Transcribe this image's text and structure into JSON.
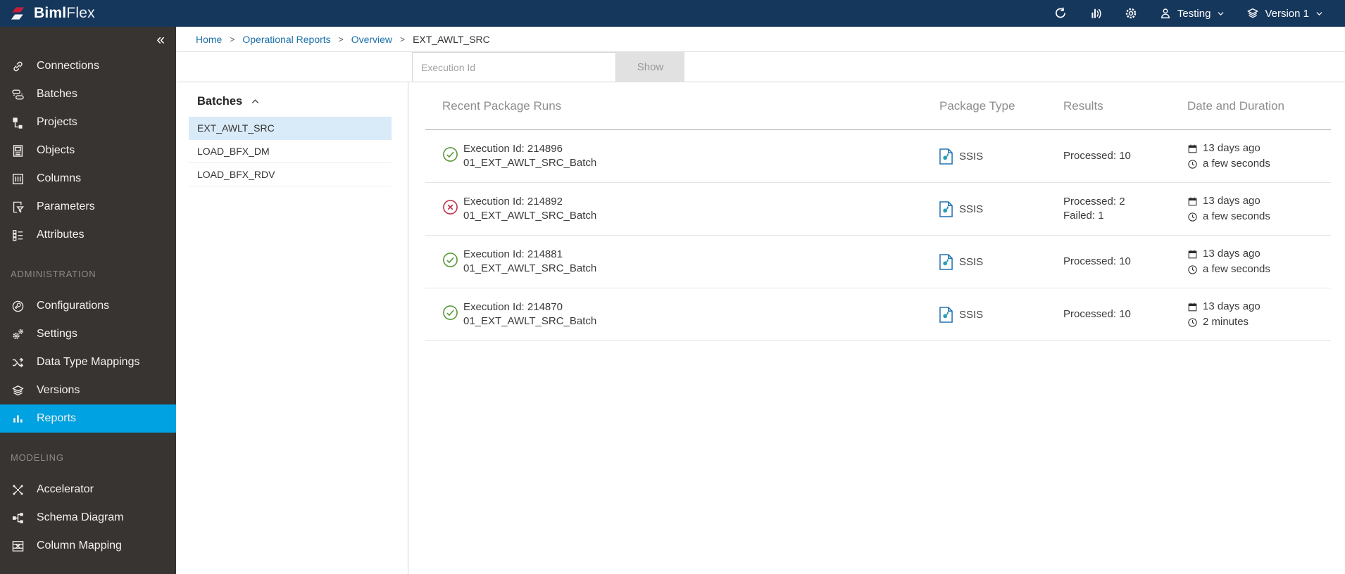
{
  "topbar": {
    "logo_bold": "Biml",
    "logo_light": "Flex",
    "user_label": "Testing",
    "version_label": "Version 1"
  },
  "breadcrumb": {
    "sep": ">",
    "home": "Home",
    "operational_reports": "Operational Reports",
    "overview": "Overview",
    "current": "EXT_AWLT_SRC"
  },
  "sidebar": {
    "collapse_glyph": "«",
    "sections": [
      {
        "items": [
          {
            "label": "Connections"
          },
          {
            "label": "Batches"
          },
          {
            "label": "Projects"
          },
          {
            "label": "Objects"
          },
          {
            "label": "Columns"
          },
          {
            "label": "Parameters"
          },
          {
            "label": "Attributes"
          }
        ]
      },
      {
        "header": "ADMINISTRATION",
        "items": [
          {
            "label": "Configurations"
          },
          {
            "label": "Settings"
          },
          {
            "label": "Data Type Mappings"
          },
          {
            "label": "Versions"
          },
          {
            "label": "Reports",
            "active": "true"
          }
        ]
      },
      {
        "header": "MODELING",
        "items": [
          {
            "label": "Accelerator"
          },
          {
            "label": "Schema Diagram"
          },
          {
            "label": "Column Mapping"
          }
        ]
      }
    ]
  },
  "batches_panel": {
    "title": "Batches",
    "items": [
      {
        "label": "EXT_AWLT_SRC",
        "selected": "true"
      },
      {
        "label": "LOAD_BFX_DM",
        "selected": "false"
      },
      {
        "label": "LOAD_BFX_RDV",
        "selected": "false"
      }
    ]
  },
  "filter": {
    "placeholder": "Execution Id",
    "show_label": "Show"
  },
  "table": {
    "col_runs": "Recent Package Runs",
    "col_package_type": "Package Type",
    "col_results": "Results",
    "col_date": "Date and Duration",
    "rows": [
      {
        "status": "success",
        "execution_id": "Execution Id: 214896",
        "batch_name": "01_EXT_AWLT_SRC_Batch",
        "package_type": "SSIS",
        "results_line1": "Processed: 10",
        "results_line2": "",
        "date": "13 days ago",
        "duration": "a few seconds"
      },
      {
        "status": "failed",
        "execution_id": "Execution Id: 214892",
        "batch_name": "01_EXT_AWLT_SRC_Batch",
        "package_type": "SSIS",
        "results_line1": "Processed: 2",
        "results_line2": "Failed: 1",
        "date": "13 days ago",
        "duration": "a few seconds"
      },
      {
        "status": "success",
        "execution_id": "Execution Id: 214881",
        "batch_name": "01_EXT_AWLT_SRC_Batch",
        "package_type": "SSIS",
        "results_line1": "Processed: 10",
        "results_line2": "",
        "date": "13 days ago",
        "duration": "a few seconds"
      },
      {
        "status": "success",
        "execution_id": "Execution Id: 214870",
        "batch_name": "01_EXT_AWLT_SRC_Batch",
        "package_type": "SSIS",
        "results_line1": "Processed: 10",
        "results_line2": "",
        "date": "13 days ago",
        "duration": "2 minutes"
      }
    ]
  },
  "colors": {
    "topbar": "#16375c",
    "sidebar": "#373431",
    "accent_blue": "#00a2e1",
    "link_blue": "#1b6fa9",
    "success_green": "#5b9a3c",
    "error_red": "#c2354f",
    "selected_row": "#d9eaf8",
    "logo_red": "#c41e3a"
  }
}
